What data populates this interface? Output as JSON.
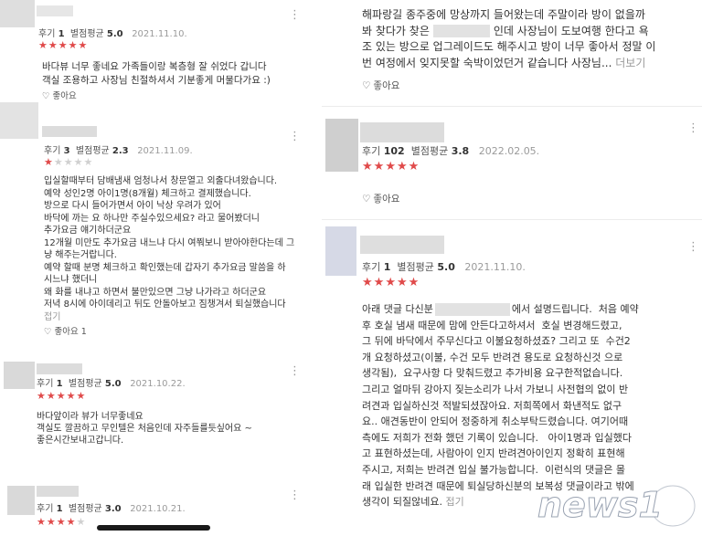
{
  "labels": {
    "count_prefix": "후기",
    "score_prefix": "별점평균",
    "like": "좋아요",
    "more": "더보기",
    "collapse": "접기"
  },
  "left_reviews": [
    {
      "count": "1",
      "score": "5.0",
      "date": "2021.11.10.",
      "stars": 5,
      "lines": [
        "바다뷰 너무 좋네요 가족들이랑 복층형 잘 쉬었다 갑니다",
        "객실 조용하고 사장님 친절하셔서 기분좋게 머물다가요 :)"
      ],
      "like": "좋아요"
    },
    {
      "count": "3",
      "score": "2.3",
      "date": "2021.11.09.",
      "stars": 1,
      "lines": [
        "입실할때부터 담배냄새 엄청나서 창문열고 외출다녀왔습니다.",
        "예약 성인2명 아이1명(8개월) 체크하고 결제했습니다.",
        "방으로 다시 들어가면서 아이 낙상 우려가 있어",
        "바닥에 까는 요 하나만 주실수있으세요? 라고 물어봤더니",
        "추가요금 얘기하더군요",
        "12개월 미만도 추가요금 내느냐 다시 여쭤보니 받아야한다는데 그",
        "냥 해주는거랍니다.",
        "예약 할때 분명 체크하고 확인했는데 갑자기 추가요금 말씀을 하",
        "시느냐 했더니",
        "왜 화를 내냐고 하면서 불만있으면 그냥 나가라고 하더군요",
        "저녁 8시에 아이데리고 뒤도 안돌아보고 짐챙겨서 퇴실했습니다"
      ],
      "collapse": "접기",
      "like": "좋아요 1"
    },
    {
      "count": "1",
      "score": "5.0",
      "date": "2021.10.22.",
      "stars": 5,
      "lines": [
        "바다앞이라 뷰가 너무좋네요",
        "객실도 깔끔하고 무인텔은 처음인데 자주들를듯싶어요 ~",
        "좋은시간보내고갑니다."
      ],
      "like": ""
    },
    {
      "count": "1",
      "score": "3.0",
      "date": "2021.10.21.",
      "stars": 4,
      "lines": [],
      "like": ""
    }
  ],
  "right_reviews": [
    {
      "lines": [
        "해파랑길 종주중에 망상까지 들어왔는데 주말이라 방이 없을까",
        "봐 찾다가 찾은",
        "인데 사장님이 도보여행 한다고 욕",
        "조 있는 방으로 업그레이드도 해주시고 방이 너무 좋아서 정말 이",
        "번 여정에서 잊지못할 숙박이었던거 같습니다 사장님..."
      ],
      "more": "더보기",
      "like": "좋아요"
    },
    {
      "count": "102",
      "score": "3.8",
      "date": "2022.02.05.",
      "stars": 5,
      "like": "좋아요"
    },
    {
      "count": "1",
      "score": "5.0",
      "date": "2021.11.10.",
      "stars": 5,
      "lines": [
        "아래 댓글 다신분",
        "에서 설명드립니다.  처음 예약",
        "후 호실 냄새 때문에 맘에 안든다고하셔서  호실 변경해드렸고,",
        "그 뒤에 바닥에서 주무신다고 이불요청하셨죠? 그리고 또  수건2",
        "개 요청하셨고(이불, 수건 모두 반려견 용도로 요청하신것 으로",
        "생각됨),  요구사항 다 맞춰드렸고 추가비용 요구한적없습니다.",
        "그리고 얼마뒤 강아지 짖는소리가 나서 가보니 사전협의 없이 반",
        "려견과 입실하신것 적발되셨잖아요. 저희쪽에서 화낸적도 없구",
        "요.. 애견동반이 안되어 정중하게 취소부탁드렸습니다. 여기어때",
        "측에도 저희가 전화 했던 기록이 있습니다.   아이1명과 입실했다",
        "고 표현하셨는데, 사람아이 인지 반려견아이인지 정확히 표현해",
        "주시고, 저희는 반려견 입실 불가능합니다.  이런식의 댓글은 몰",
        "래 입실한 반려견 때문에 퇴실당하신분의 보복성 댓글이라고 밖에",
        "생각이 되질않네요."
      ],
      "collapse": "접기"
    }
  ],
  "watermark": {
    "text": "news1"
  },
  "colors": {
    "star": "#e04a4a",
    "star_off": "#d0d0d0",
    "placeholder": "#d9d9d9",
    "meta_gray": "#9a9a9a",
    "watermark": "#ffffff"
  }
}
